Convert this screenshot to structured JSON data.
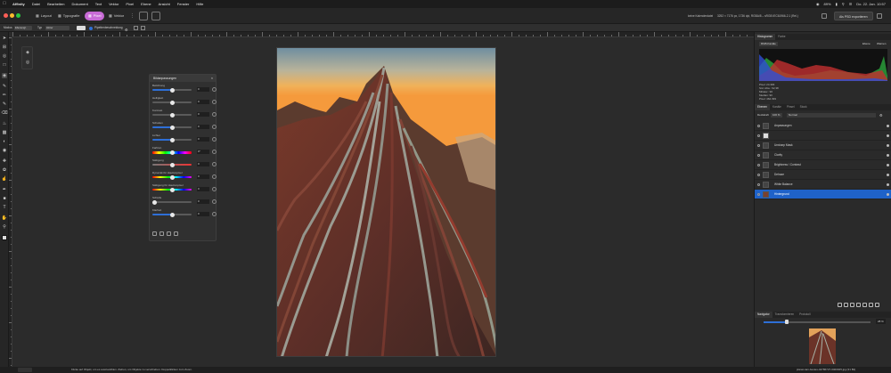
{
  "menubar": {
    "app": "Affinity",
    "items": [
      "Datei",
      "Bearbeiten",
      "Dokument",
      "Text",
      "Vektor",
      "Pixel",
      "Ebene",
      "Ansicht",
      "Fenster",
      "Hilfe"
    ],
    "battery": "89%",
    "datetime": "Do. 22. Jan. 10:57"
  },
  "toolbar": {
    "personas": [
      "Layout",
      "Typografie",
      "Pixel",
      "Vektor"
    ],
    "active_persona": "Pixel",
    "doc_name": "keine Kalenderdatei",
    "doc_info": "3252 × 7176 px, 1736 dpi, RGBA/8 – sRGB IEC61966-2.1 (Rel.)",
    "save_button": "Als PSD exportieren"
  },
  "context": {
    "modus_label": "Modus",
    "modus_value": "Ebenengl.",
    "typ_label": "Typ",
    "typ_value": "Hinter",
    "pipette_label": "Pipettenbeschneidung"
  },
  "adjust_panel": {
    "title": "Bildanpassungen",
    "tab2": "",
    "rows": [
      {
        "label": "Belichtung",
        "value": "0"
      },
      {
        "label": "Helligkeit",
        "value": "0"
      },
      {
        "label": "Kontrast",
        "value": "0"
      },
      {
        "label": "Schatten",
        "value": "0"
      },
      {
        "label": "Lichter",
        "value": "0"
      },
      {
        "label": "Weißpunkt",
        "value": "0"
      },
      {
        "label": "Farbton",
        "value": "0°"
      },
      {
        "label": "Sättigung",
        "value": "0"
      },
      {
        "label": "Dynamik für Hauttonpixel",
        "value": "0"
      },
      {
        "label": "Sättigung für Hauttonpixel",
        "value": "0"
      },
      {
        "label": "Schärfe",
        "value": "0"
      },
      {
        "label": "Klarheit",
        "value": "0"
      }
    ]
  },
  "right_panel": {
    "histo_tabs": [
      "Histogramm",
      "Farbe"
    ],
    "histo_channel": "RGB-Kanäle",
    "histo_options": [
      "Ebene",
      "Warnen"
    ],
    "histo_stats": [
      "Pixel: 24.366",
      "Std. Abw.: 62,38",
      "Mittelw.: 96",
      "Median: 90",
      "Pixel: 462.399"
    ],
    "layer_tabs": [
      "Ebenen",
      "Kanäle",
      "Pinsel",
      "Stock"
    ],
    "opacity_label": "Deckkraft",
    "opacity_value": "100 %",
    "blend_mode": "Normal",
    "layers": [
      {
        "name": "Anpassungen",
        "selected": false
      },
      {
        "name": "",
        "selected": false
      },
      {
        "name": "Unsharp Mask",
        "selected": false
      },
      {
        "name": "Clarity",
        "selected": false
      },
      {
        "name": "Brightness / Contrast",
        "selected": false
      },
      {
        "name": "Dehaze",
        "selected": false
      },
      {
        "name": "White Balance",
        "selected": false
      },
      {
        "name": "Hintergrund",
        "selected": true
      }
    ],
    "nav_tabs": [
      "Navigator",
      "Transformieren",
      "Protokoll"
    ],
    "zoom_value": "28 %"
  },
  "statusbar": {
    "text": "Klicke auf Objekt, um es auszuwählen. Ziehen, um Objekte zu verschieben. Doppelklicken zum Zoom.",
    "file": "planet-iam-bestes-42786727-0400025.jpg (31 Bit)"
  },
  "colors": {
    "accent": "#1f62c8",
    "persona_active": "#c86bd6"
  }
}
